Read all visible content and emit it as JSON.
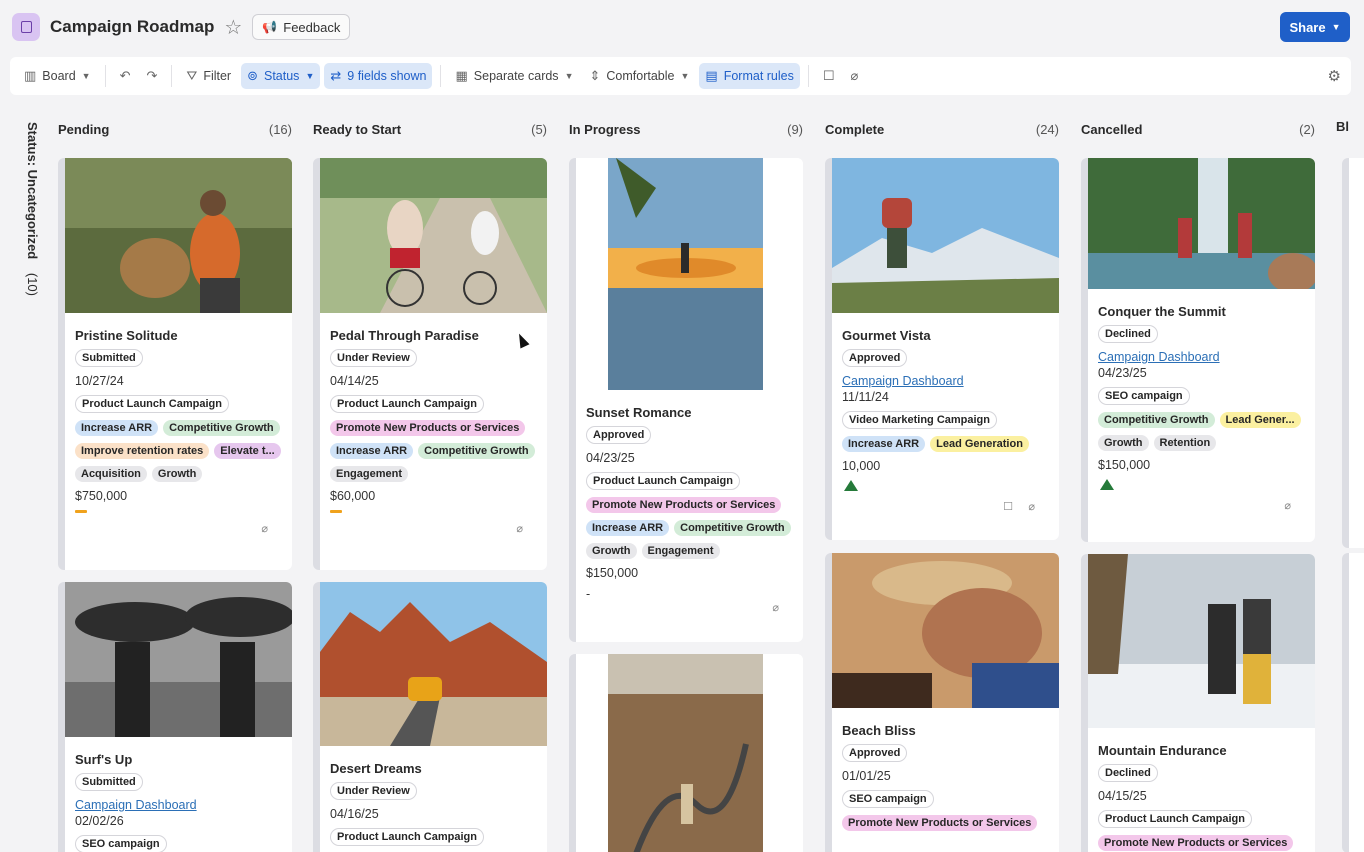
{
  "header": {
    "title": "Campaign Roadmap",
    "feedback_label": "Feedback",
    "share_label": "Share"
  },
  "toolbar": {
    "board_label": "Board",
    "filter_label": "Filter",
    "status_label": "Status",
    "fields_label": "9 fields shown",
    "separate_label": "Separate cards",
    "density_label": "Comfortable",
    "format_label": "Format rules"
  },
  "uncategorized": {
    "label": "Status: Uncategorized",
    "count": "(10)"
  },
  "columns": [
    {
      "name": "Pending",
      "count": "(16)"
    },
    {
      "name": "Ready to Start",
      "count": "(5)"
    },
    {
      "name": "In Progress",
      "count": "(9)"
    },
    {
      "name": "Complete",
      "count": "(24)"
    },
    {
      "name": "Cancelled",
      "count": "(2)"
    },
    {
      "name": "Bl"
    }
  ],
  "cards": {
    "c1": {
      "title": "Pristine Solitude",
      "status": "Submitted",
      "date": "10/27/24",
      "campaign": "Product Launch Campaign",
      "tags1": [
        "Increase ARR",
        "Competitive Growth"
      ],
      "tags2": [
        "Improve retention rates",
        "Elevate t..."
      ],
      "tags3": [
        "Acquisition",
        "Growth"
      ],
      "budget": "$750,000"
    },
    "c2": {
      "title": "Surf's Up",
      "status": "Submitted",
      "link": "Campaign Dashboard",
      "date": "02/02/26",
      "campaign": "SEO campaign"
    },
    "c3": {
      "title": "Pedal Through Paradise",
      "status": "Under Review",
      "date": "04/14/25",
      "campaign": "Product Launch Campaign",
      "tags1": [
        "Promote New Products or Services"
      ],
      "tags2": [
        "Increase ARR",
        "Competitive Growth"
      ],
      "tags3": [
        "Engagement"
      ],
      "budget": "$60,000"
    },
    "c4": {
      "title": "Desert Dreams",
      "status": "Under Review",
      "date": "04/16/25",
      "campaign": "Product Launch Campaign"
    },
    "c5": {
      "title": "Sunset Romance",
      "status": "Approved",
      "date": "04/23/25",
      "campaign": "Product Launch Campaign",
      "tags1": [
        "Promote New Products or Services"
      ],
      "tags2": [
        "Increase ARR",
        "Competitive Growth"
      ],
      "tags3": [
        "Growth",
        "Engagement"
      ],
      "budget": "$150,000",
      "extra": "-"
    },
    "c7": {
      "title": "Gourmet Vista",
      "status": "Approved",
      "link": "Campaign Dashboard",
      "date": "11/11/24",
      "campaign": "Video Marketing Campaign",
      "tags1": [
        "Increase ARR",
        "Lead Generation"
      ],
      "budget": "10,000"
    },
    "c8": {
      "title": "Beach Bliss",
      "status": "Approved",
      "date": "01/01/25",
      "campaign": "SEO campaign",
      "tags1": [
        "Promote New Products or Services"
      ]
    },
    "c9": {
      "title": "Conquer the Summit",
      "status": "Declined",
      "link": "Campaign Dashboard",
      "date": "04/23/25",
      "campaign": "SEO campaign",
      "tags1": [
        "Competitive Growth",
        "Lead Gener..."
      ],
      "tags2": [
        "Growth",
        "Retention"
      ],
      "budget": "$150,000"
    },
    "c10": {
      "title": "Mountain Endurance",
      "status": "Declined",
      "date": "04/15/25",
      "campaign": "Product Launch Campaign",
      "tags1": [
        "Promote New Products or Services"
      ]
    }
  }
}
